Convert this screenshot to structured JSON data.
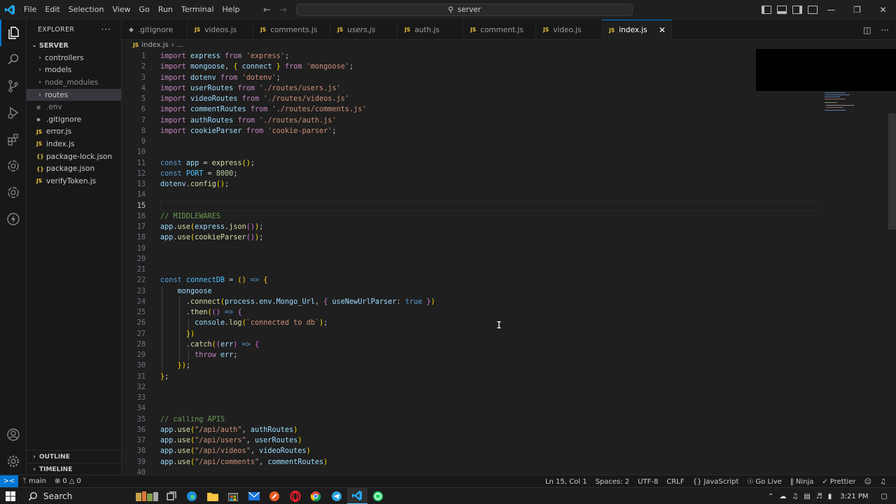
{
  "window": {
    "search_text": "server",
    "menu": [
      "File",
      "Edit",
      "Selection",
      "View",
      "Go",
      "Run",
      "Terminal",
      "Help"
    ]
  },
  "sidebar": {
    "title": "EXPLORER",
    "root": "SERVER",
    "items": [
      {
        "label": "controllers",
        "type": "folder"
      },
      {
        "label": "models",
        "type": "folder"
      },
      {
        "label": "node_modules",
        "type": "folder"
      },
      {
        "label": "routes",
        "type": "folder"
      },
      {
        "label": ".env",
        "type": "env"
      },
      {
        "label": ".gitignore",
        "type": "git"
      },
      {
        "label": "error.js",
        "type": "js"
      },
      {
        "label": "index.js",
        "type": "js"
      },
      {
        "label": "package-lock.json",
        "type": "json"
      },
      {
        "label": "package.json",
        "type": "json"
      },
      {
        "label": "verifyToken.js",
        "type": "js"
      }
    ],
    "outline": "OUTLINE",
    "timeline": "TIMELINE"
  },
  "tabs": [
    {
      "label": ".gitignore",
      "type": "git"
    },
    {
      "label": "videos.js",
      "type": "js"
    },
    {
      "label": "comments.js",
      "type": "js"
    },
    {
      "label": "users.js",
      "type": "js"
    },
    {
      "label": "auth.js",
      "type": "js"
    },
    {
      "label": "comment.js",
      "type": "js"
    },
    {
      "label": "video.js",
      "type": "js"
    },
    {
      "label": "index.js",
      "type": "js"
    }
  ],
  "breadcrumb": {
    "file": "index.js",
    "trail": "..."
  },
  "code": {
    "line_numbers": [
      "1",
      "2",
      "3",
      "4",
      "5",
      "6",
      "7",
      "8",
      "9",
      "10",
      "11",
      "12",
      "13",
      "14",
      "15",
      "16",
      "17",
      "18",
      "19",
      "20",
      "21",
      "22",
      "23",
      "24",
      "25",
      "26",
      "27",
      "28",
      "29",
      "30",
      "31",
      "32",
      "33",
      "34",
      "35",
      "36",
      "37",
      "38",
      "39",
      "40"
    ],
    "lines": [
      "import express from 'express';",
      "import mongoose, { connect } from 'mongoose';",
      "import dotenv from 'dotenv';",
      "import userRoutes from './routes/users.js'",
      "import videoRoutes from './routes/videos.js'",
      "import commentRoutes from './routes/comments.js'",
      "import authRoutes from './routes/auth.js'",
      "import cookieParser from 'cookie-parser';",
      "",
      "",
      "const app = express();",
      "const PORT = 8000;",
      "dotenv.config();",
      "",
      "",
      "// MIDDLEWARES",
      "app.use(express.json());",
      "app.use(cookieParser());",
      "",
      "",
      "",
      "const connectDB = () => {",
      "    mongoose",
      "      .connect(process.env.Mongo_Url, { useNewUrlParser: true })",
      "      .then(() => {",
      "        console.log(`connected to db`);",
      "      })",
      "      .catch((err) => {",
      "        throw err;",
      "    });",
      "};",
      "",
      "",
      "",
      "// calling APIS",
      "app.use(\"/api/auth\", authRoutes)",
      "app.use(\"/api/users\", userRoutes)",
      "app.use(\"/api/videos\", videoRoutes)",
      "app.use(\"/api/comments\", commentRoutes)",
      ""
    ]
  },
  "statusbar": {
    "branch": "main",
    "errors": "0",
    "warnings": "0",
    "position": "Ln 15, Col 1",
    "spaces": "Spaces: 2",
    "encoding": "UTF-8",
    "eol": "CRLF",
    "language": "JavaScript",
    "golive": "Go Live",
    "ninja": "Ninja",
    "prettier": "Prettier"
  },
  "taskbar": {
    "search": "Search",
    "time": "3:21 PM"
  }
}
